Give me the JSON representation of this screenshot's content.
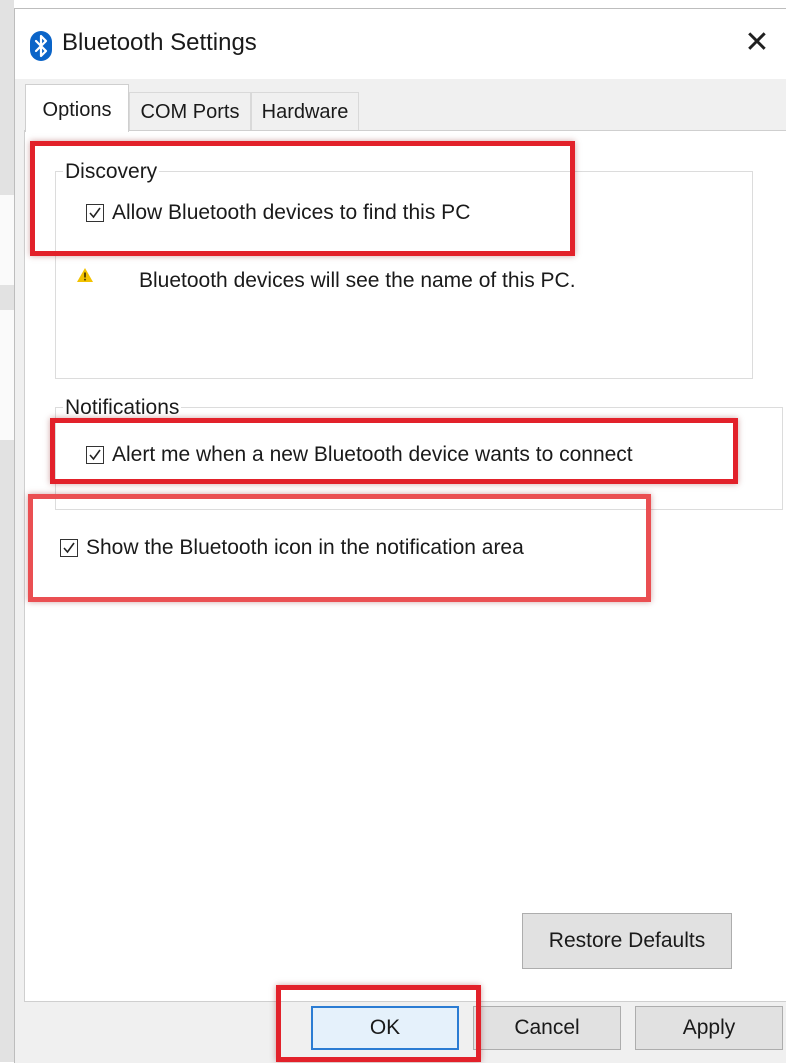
{
  "window": {
    "title": "Bluetooth Settings",
    "close_glyph": "✕"
  },
  "tabs": [
    {
      "label": "Options",
      "active": true
    },
    {
      "label": "COM Ports",
      "active": false
    },
    {
      "label": "Hardware",
      "active": false
    }
  ],
  "discovery": {
    "heading": "Discovery",
    "allow_label": "Allow Bluetooth devices to find this PC",
    "allow_checked": true,
    "warning_text": "Bluetooth devices will see the name of this PC.",
    "warning_icon": "warning-icon"
  },
  "notifications": {
    "heading": "Notifications",
    "alert_label": "Alert me when a new Bluetooth device wants to connect",
    "alert_checked": true
  },
  "tray": {
    "show_icon_label": "Show the Bluetooth icon in the notification area",
    "show_icon_checked": true
  },
  "buttons": {
    "restore_defaults": "Restore Defaults",
    "ok": "OK",
    "cancel": "Cancel",
    "apply": "Apply"
  },
  "colors": {
    "highlight": "#e2212a",
    "bluetooth_brand": "#0a64c8",
    "warning": "#f2c200"
  }
}
